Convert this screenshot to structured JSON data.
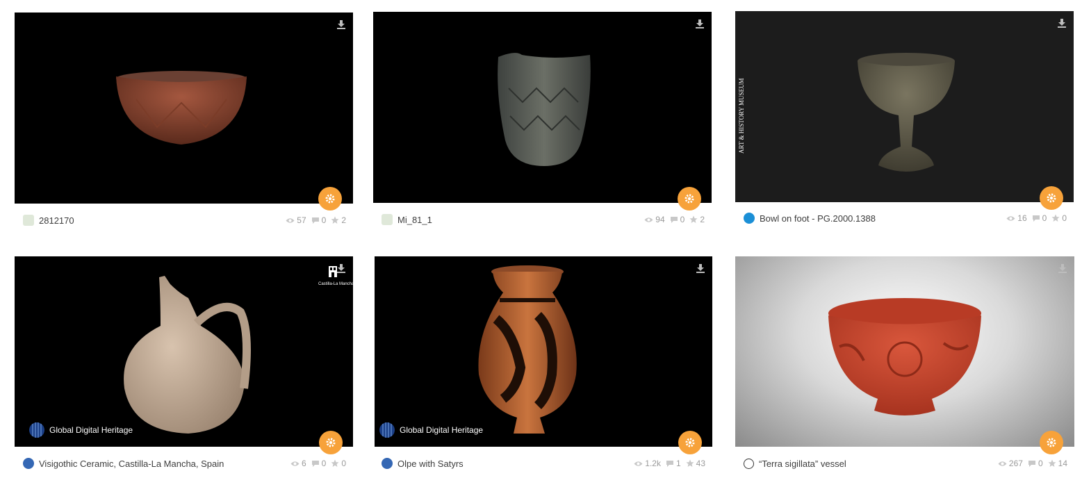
{
  "cards": [
    {
      "title": "2812170",
      "views": "57",
      "comments": "0",
      "likes": "2"
    },
    {
      "title": "Mi_81_1",
      "views": "94",
      "comments": "0",
      "likes": "2"
    },
    {
      "title": "Bowl on foot - PG.2000.1388",
      "views": "16",
      "comments": "0",
      "likes": "0",
      "watermark": "ART & HISTORY MUSEUM"
    },
    {
      "title": "Visigothic Ceramic, Castilla-La Mancha, Spain",
      "views": "6",
      "comments": "0",
      "likes": "0",
      "watermark": "Global Digital Heritage",
      "badge": "Castilla-La Mancha"
    },
    {
      "title": "Olpe with Satyrs",
      "views": "1.2k",
      "comments": "1",
      "likes": "43",
      "watermark": "Global Digital Heritage"
    },
    {
      "title": "“Terra sigillata” vessel",
      "views": "267",
      "comments": "0",
      "likes": "14"
    }
  ],
  "icons": {
    "download": "download-icon",
    "settings": "gear-icon",
    "views": "eye-icon",
    "comments": "comment-icon",
    "likes": "star-icon"
  },
  "colors": {
    "accent": "#f7a23a",
    "stats": "#9a9a9a",
    "title": "#3c3c3c"
  }
}
